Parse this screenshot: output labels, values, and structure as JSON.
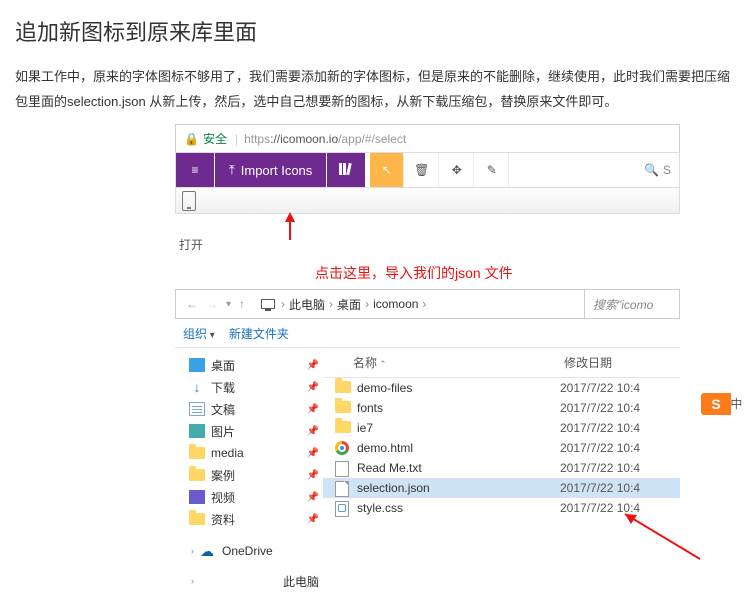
{
  "heading": "追加新图标到原来库里面",
  "intro": "如果工作中，原来的字体图标不够用了，我们需要添加新的字体图标，但是原来的不能删除，继续使用，此时我们需要把压缩包里面的selection.json 从新上传，然后，选中自己想要新的图标，从新下载压缩包，替换原来文件即可。",
  "browser": {
    "secure_label": "安全",
    "url_scheme": "https",
    "url_host": "://icomoon.io",
    "url_path": "/app/#/select"
  },
  "toolbar": {
    "import_label": "Import Icons",
    "search_placeholder": "S"
  },
  "annotation": "点击这里，导入我们的json 文件",
  "explorer": {
    "open_label": "打开",
    "breadcrumb": {
      "pc": "此电脑",
      "desktop": "桌面",
      "folder": "icomoon"
    },
    "search_placeholder": "搜索\"icomo",
    "cmd_organize": "组织",
    "cmd_newfolder": "新建文件夹",
    "tree": {
      "desktop": "桌面",
      "downloads": "下载",
      "documents": "文稿",
      "pictures": "图片",
      "media": "media",
      "cases": "案例",
      "videos": "视频",
      "data": "资料",
      "onedrive": "OneDrive",
      "thispc": "此电脑"
    },
    "columns": {
      "name": "名称",
      "date": "修改日期"
    },
    "files": [
      {
        "name": "demo-files",
        "date": "2017/7/22 10:4",
        "kind": "folder"
      },
      {
        "name": "fonts",
        "date": "2017/7/22 10:4",
        "kind": "folder"
      },
      {
        "name": "ie7",
        "date": "2017/7/22 10:4",
        "kind": "folder"
      },
      {
        "name": "demo.html",
        "date": "2017/7/22 10:4",
        "kind": "chrome"
      },
      {
        "name": "Read Me.txt",
        "date": "2017/7/22 10:4",
        "kind": "txt"
      },
      {
        "name": "selection.json",
        "date": "2017/7/22 10:4",
        "kind": "file",
        "selected": true
      },
      {
        "name": "style.css",
        "date": "2017/7/22 10:4",
        "kind": "css"
      }
    ]
  },
  "ime_badge": "S",
  "ime_text": "中 ,"
}
